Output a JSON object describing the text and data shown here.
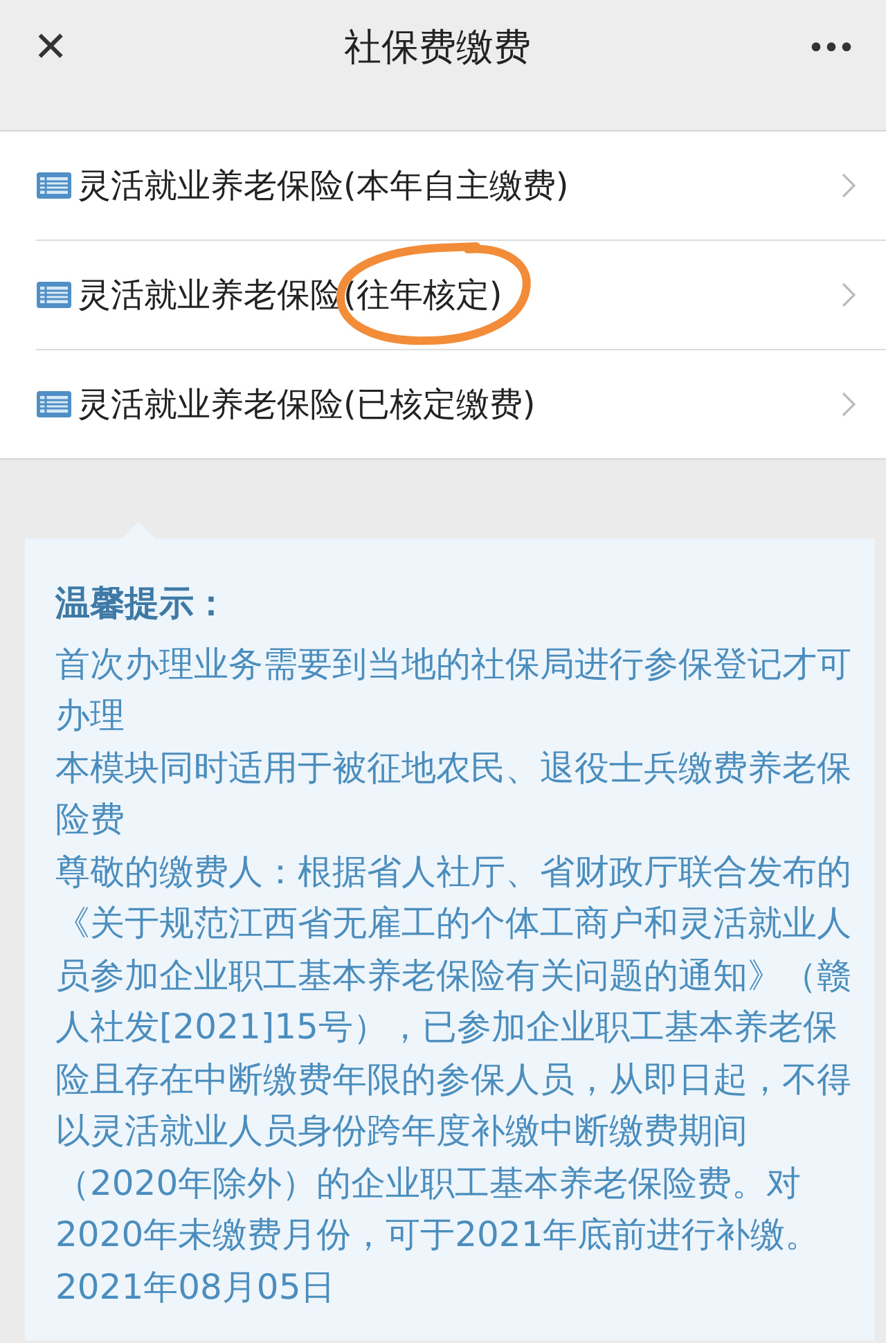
{
  "header": {
    "close": "✕",
    "title": "社保费缴费",
    "more": "•••"
  },
  "items": [
    {
      "label": "灵活就业养老保险(本年自主缴费)",
      "circled": false
    },
    {
      "label": "灵活就业养老保险(往年核定)",
      "circled": true
    },
    {
      "label": "灵活就业养老保险(已核定缴费)",
      "circled": false
    }
  ],
  "notice": {
    "title": "温馨提示：",
    "paragraphs": [
      "首次办理业务需要到当地的社保局进行参保登记才可办理",
      "本模块同时适用于被征地农民、退役士兵缴费养老保险费",
      "尊敬的缴费人：根据省人社厅、省财政厅联合发布的《关于规范江西省无雇工的个体工商户和灵活就业人员参加企业职工基本养老保险有关问题的通知》（赣人社发[2021]15号），已参加企业职工基本养老保险且存在中断缴费年限的参保人员，从即日起，不得以灵活就业人员身份跨年度补缴中断缴费期间（2020年除外）的企业职工基本养老保险费。对2020年未缴费月份，可于2021年底前进行补缴。2021年08月05日"
    ]
  }
}
